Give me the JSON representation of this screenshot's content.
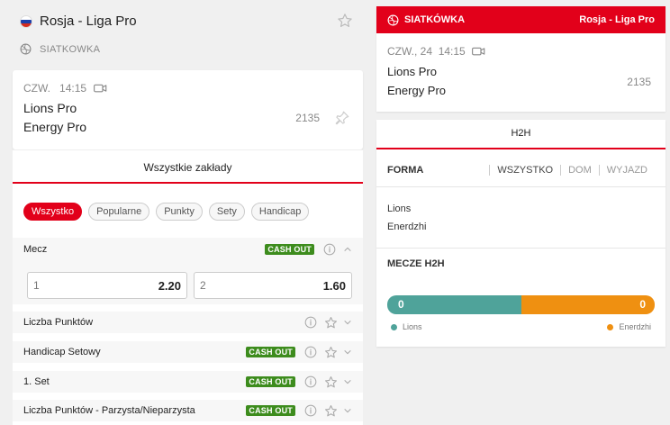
{
  "league": {
    "title": "Rosja - Liga Pro",
    "sport": "SIATKOWKA",
    "flag_colors": [
      "#ffffff",
      "#1c3faa",
      "#d52b1e"
    ]
  },
  "match": {
    "day": "CZW.",
    "time": "14:15",
    "home": "Lions Pro",
    "away": "Energy Pro",
    "id": "2135"
  },
  "bets": {
    "tab_label": "Wszystkie zakłady",
    "filters": [
      "Wszystko",
      "Popularne",
      "Punkty",
      "Sety",
      "Handicap"
    ],
    "active_filter": "Wszystko",
    "cashout_label": "CASH OUT",
    "main_market": {
      "name": "Mecz",
      "odds": [
        {
          "label": "1",
          "value": "2.20"
        },
        {
          "label": "2",
          "value": "1.60"
        }
      ]
    },
    "markets": [
      {
        "name": "Liczba Punktów",
        "cashout": false
      },
      {
        "name": "Handicap Setowy",
        "cashout": true
      },
      {
        "name": "1. Set",
        "cashout": true
      },
      {
        "name": "Liczba Punktów - Parzysta/Nieparzysta",
        "cashout": true
      }
    ]
  },
  "side_card": {
    "sport": "SIATKÓWKA",
    "league": "Rosja - Liga Pro",
    "datetime": "CZW., 24",
    "time": "14:15",
    "home": "Lions Pro",
    "away": "Energy Pro",
    "id": "2135"
  },
  "h2h": {
    "tab_label": "H2H",
    "forma_label": "FORMA",
    "forma_filters": [
      "WSZYSTKO",
      "DOM",
      "WYJAZD"
    ],
    "team_a": "Lions",
    "team_b": "Enerdzhi",
    "mecze_label": "MECZE H2H",
    "score_a": "0",
    "score_b": "0",
    "color_a": "#4fa39a",
    "color_b": "#ef9011",
    "bar_share_a": 0.5
  },
  "colors": {
    "accent": "#e2001a",
    "cashout": "#3d8c1d"
  }
}
